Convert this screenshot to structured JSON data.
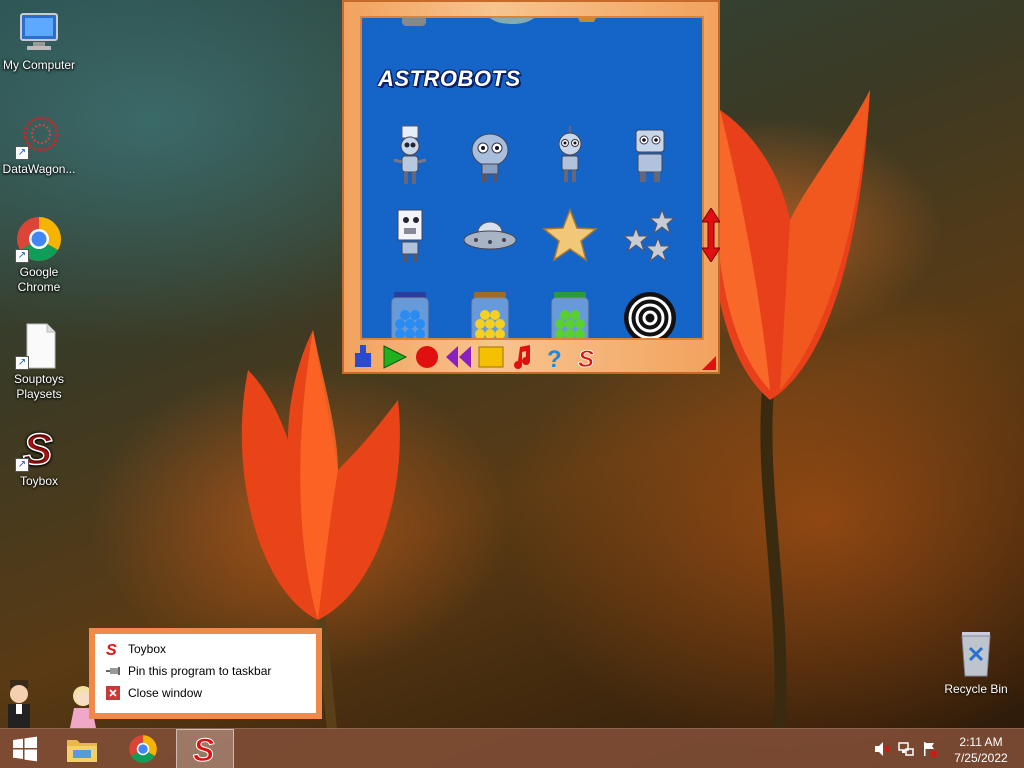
{
  "desktop": {
    "icons": [
      {
        "label": "My Computer"
      },
      {
        "label": "DataWagon..."
      },
      {
        "label": "Google Chrome"
      },
      {
        "label": "Souptoys Playsets"
      },
      {
        "label": "Toybox"
      }
    ],
    "recycle_bin": {
      "label": "Recycle Bin"
    }
  },
  "toybox_window": {
    "section_title": "ASTROBOTS",
    "toys": [
      {
        "icon": "robot-tall-icon"
      },
      {
        "icon": "robot-round-icon"
      },
      {
        "icon": "robot-slim-icon"
      },
      {
        "icon": "robot-box-icon"
      },
      {
        "icon": "robot-square-icon"
      },
      {
        "icon": "ufo-icon"
      },
      {
        "icon": "gold-star-icon"
      },
      {
        "icon": "silver-stars-icon"
      },
      {
        "icon": "blue-gumball-jar-icon"
      },
      {
        "icon": "yellow-gumball-jar-icon"
      },
      {
        "icon": "green-gumball-jar-icon"
      },
      {
        "icon": "hypno-spiral-icon"
      }
    ],
    "toolbar": [
      {
        "icon": "clamp-icon"
      },
      {
        "icon": "play-icon"
      },
      {
        "icon": "record-icon"
      },
      {
        "icon": "rewind-icon"
      },
      {
        "icon": "stop-icon"
      },
      {
        "icon": "music-note-icon"
      },
      {
        "icon": "help-icon"
      },
      {
        "icon": "souptoys-logo-icon"
      }
    ]
  },
  "jump_list": {
    "items": [
      {
        "label": "Toybox",
        "icon": "toybox-logo-icon"
      },
      {
        "label": "Pin this program to taskbar",
        "icon": "pin-icon"
      },
      {
        "label": "Close window",
        "icon": "close-icon"
      }
    ]
  },
  "taskbar": {
    "clock": {
      "time": "2:11 AM",
      "date": "7/25/2022"
    },
    "tasks": [
      {
        "icon": "windows-start-icon"
      },
      {
        "icon": "file-explorer-icon"
      },
      {
        "icon": "chrome-icon"
      },
      {
        "icon": "toybox-logo-icon"
      }
    ],
    "tray": [
      {
        "icon": "volume-muted-icon"
      },
      {
        "icon": "network-icon"
      },
      {
        "icon": "action-center-flag-icon"
      }
    ]
  },
  "colors": {
    "toybox_blue": "#1565c8",
    "toybox_frame": "#f2a25e",
    "taskbar": "#824e37",
    "souptoys_red": "#e01010"
  }
}
